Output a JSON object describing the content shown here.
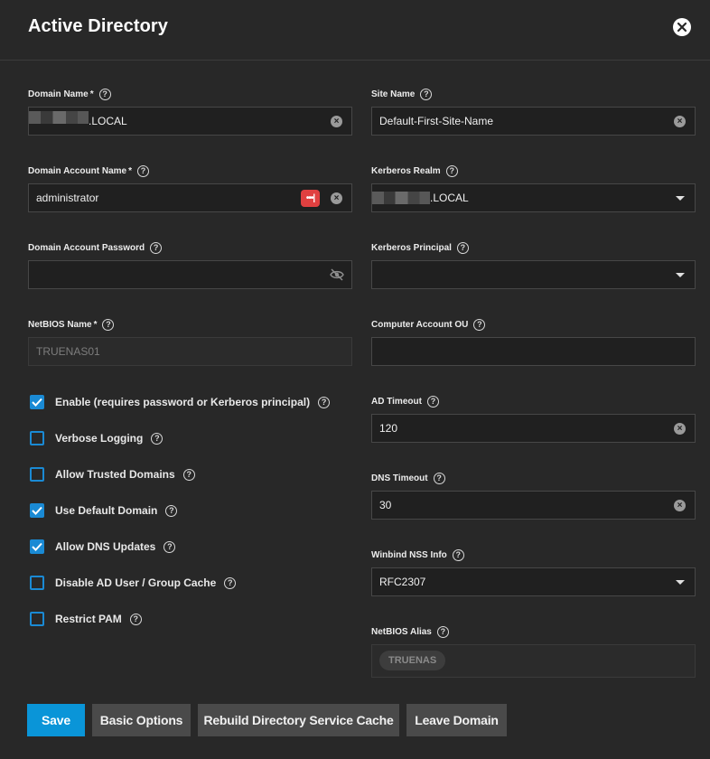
{
  "dialog": {
    "title": "Active Directory"
  },
  "left": {
    "domain_name": {
      "label": "Domain Name",
      "required": "*",
      "value": ".LOCAL"
    },
    "domain_account_name": {
      "label": "Domain Account Name",
      "required": "*",
      "value": "administrator"
    },
    "domain_account_password": {
      "label": "Domain Account Password",
      "value": ""
    },
    "netbios_name": {
      "label": "NetBIOS Name",
      "required": "*",
      "value": "TRUENAS01"
    },
    "checkboxes": [
      {
        "label": "Enable (requires password or Kerberos principal)",
        "checked": true
      },
      {
        "label": "Verbose Logging",
        "checked": false
      },
      {
        "label": "Allow Trusted Domains",
        "checked": false
      },
      {
        "label": "Use Default Domain",
        "checked": true
      },
      {
        "label": "Allow DNS Updates",
        "checked": true
      },
      {
        "label": "Disable AD User / Group Cache",
        "checked": false
      },
      {
        "label": "Restrict PAM",
        "checked": false
      }
    ]
  },
  "right": {
    "site_name": {
      "label": "Site Name",
      "value": "Default-First-Site-Name"
    },
    "kerberos_realm": {
      "label": "Kerberos Realm",
      "value": ".LOCAL"
    },
    "kerberos_principal": {
      "label": "Kerberos Principal",
      "value": ""
    },
    "computer_account_ou": {
      "label": "Computer Account OU",
      "value": ""
    },
    "ad_timeout": {
      "label": "AD Timeout",
      "value": "120"
    },
    "dns_timeout": {
      "label": "DNS Timeout",
      "value": "30"
    },
    "winbind_nss_info": {
      "label": "Winbind NSS Info",
      "value": "RFC2307"
    },
    "netbios_alias": {
      "label": "NetBIOS Alias",
      "chip": "TRUENAS"
    }
  },
  "buttons": {
    "save": "Save",
    "basic_options": "Basic Options",
    "rebuild_cache": "Rebuild Directory Service Cache",
    "leave_domain": "Leave Domain"
  },
  "icons": {
    "help": "?",
    "clear": "×",
    "key": "•••|"
  },
  "colors": {
    "accent": "#0a95d8",
    "checkbox": "#1a8ad4",
    "key_icon": "#e04040"
  }
}
